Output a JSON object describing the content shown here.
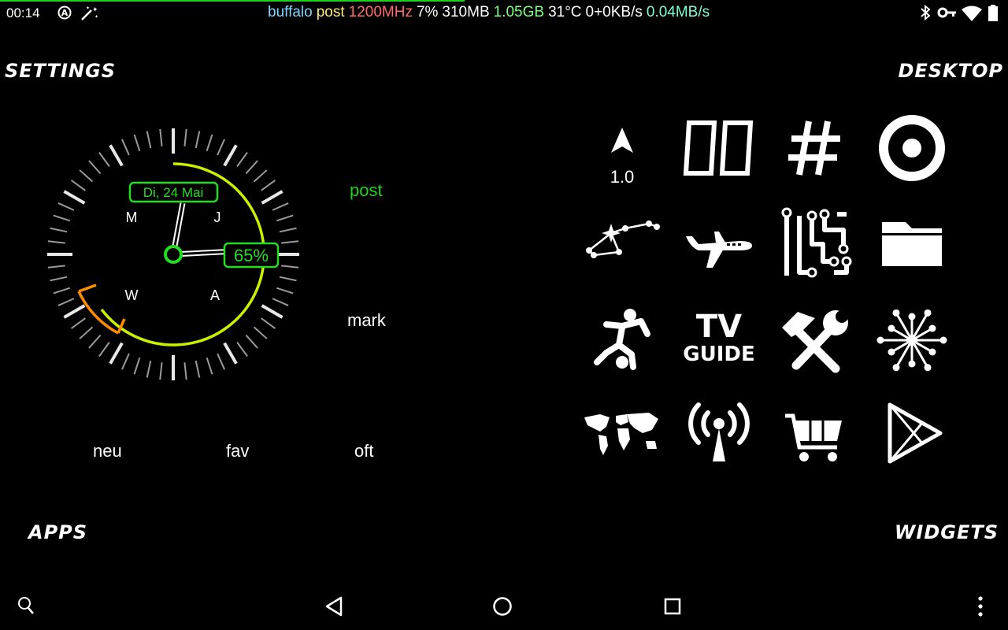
{
  "status_bar": {
    "time": "00:14",
    "icons_left": [
      "accessibility-icon",
      "magic-wand-icon"
    ],
    "stats": {
      "host": "buffalo",
      "app": "post",
      "cpu_freq": "1200MHz",
      "cpu_pct": "7%",
      "mem_used": "310MB",
      "mem_free": "1.05GB",
      "temp": "31°C",
      "net_rate": "0+0KB/s",
      "net_total": "0.04MB/s"
    },
    "icons_right": [
      "bluetooth-icon",
      "key-icon",
      "wifi-icon",
      "battery-icon"
    ],
    "colors": {
      "host": "#7fd4ff",
      "app": "#ffe97a",
      "cpu_freq": "#ff6b6b",
      "cpu_pct": "#ffffff",
      "mem_used": "#ffffff",
      "mem_free": "#7fff7f",
      "temp": "#ffffff",
      "net_rate": "#ffffff",
      "net_total": "#7fffd4"
    }
  },
  "corners": {
    "settings": "SETTINGS",
    "desktop": "DESKTOP",
    "apps": "APPS",
    "widgets": "WIDGETS"
  },
  "clock": {
    "date": "Di, 24 Mai",
    "battery": "65%",
    "letters": {
      "top_left": "M",
      "top_right": "J",
      "bottom_left": "W",
      "bottom_right": "A"
    },
    "accent": "#22dd22",
    "arc_color": "#c8f000",
    "warn_color": "#ff8c00"
  },
  "shortcuts": {
    "post": "post",
    "mark": "mark",
    "neu": "neu",
    "fav": "fav",
    "oft": "oft",
    "post_color": "#1fd11f"
  },
  "grid": {
    "compass_value": "1.0",
    "tv_guide_line1": "TV",
    "tv_guide_line2": "GUIDE",
    "tiles": [
      "compass-icon",
      "digital-clock-icon",
      "hash-icon",
      "target-icon",
      "constellation-icon",
      "airplane-icon",
      "circuit-icon",
      "folder-icon",
      "soccer-player-icon",
      "tv-guide-icon",
      "tools-icon",
      "network-burst-icon",
      "world-map-icon",
      "radio-tower-icon",
      "shopping-cart-icon",
      "play-store-icon"
    ]
  },
  "navbar": {
    "icons": [
      "search-icon",
      "back-icon",
      "home-icon",
      "recents-icon",
      "overflow-menu-icon"
    ]
  }
}
